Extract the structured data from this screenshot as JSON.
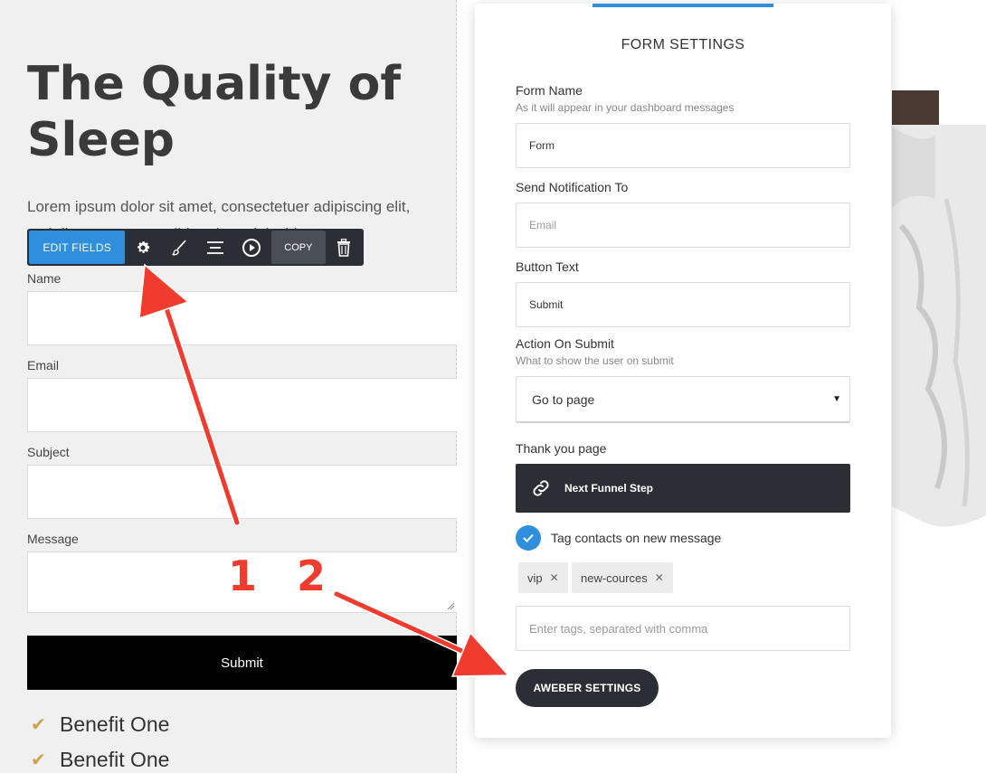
{
  "page": {
    "headline": "The Quality of Sleep",
    "intro_text": "Lorem ipsum dolor sit amet, consectetuer adipiscing elit, sed diam nonummy nibh euismod tincidunt ut"
  },
  "toolbar": {
    "edit_fields_label": "EDIT FIELDS",
    "copy_label": "COPY",
    "icons": [
      "gear-icon",
      "brush-icon",
      "align-icon",
      "play-icon",
      "trash-icon"
    ]
  },
  "form": {
    "fields": [
      {
        "label": "Name"
      },
      {
        "label": "Email"
      },
      {
        "label": "Subject"
      },
      {
        "label": "Message"
      }
    ],
    "submit_label": "Submit"
  },
  "benefits": [
    "Benefit One",
    "Benefit One"
  ],
  "annotations": [
    "1",
    "2"
  ],
  "settings": {
    "title": "FORM SETTINGS",
    "form_name_label": "Form Name",
    "form_name_hint": "As it will appear in your dashboard messages",
    "form_name_value": "Form",
    "notify_label": "Send Notification To",
    "notify_placeholder": "Email",
    "button_text_label": "Button Text",
    "button_text_value": "Submit",
    "action_label": "Action On Submit",
    "action_hint": "What to show the user on submit",
    "action_value": "Go to page",
    "thankyou_label": "Thank you page",
    "thankyou_button": "Next Funnel Step",
    "tag_checkbox_label": "Tag contacts on new message",
    "tags": [
      "vip",
      "new-cources"
    ],
    "tags_placeholder": "Enter tags, separated with comma",
    "aweber_button": "AWEBER SETTINGS"
  },
  "colors": {
    "accent": "#2f8fdd",
    "dark": "#2b2e35",
    "arrow": "#f03c2e",
    "check": "#c9a44a"
  }
}
